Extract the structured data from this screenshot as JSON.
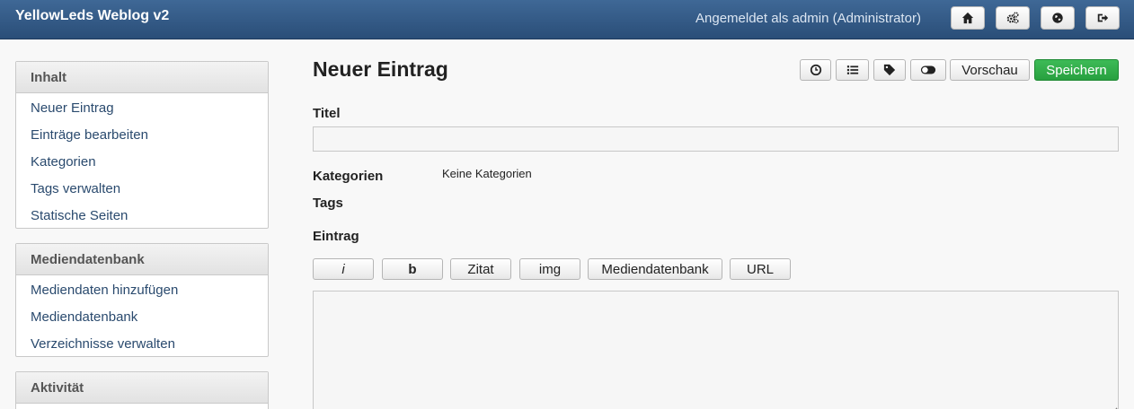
{
  "app": {
    "brand": "YellowLeds Weblog v2",
    "user_info": "Angemeldet als admin (Administrator)",
    "top_icons": [
      "home-icon",
      "settings-icon",
      "globe-icon",
      "logout-icon"
    ]
  },
  "sidebar": {
    "sections": [
      {
        "title": "Inhalt",
        "items": [
          "Neuer Eintrag",
          "Einträge bearbeiten",
          "Kategorien",
          "Tags verwalten",
          "Statische Seiten"
        ]
      },
      {
        "title": "Mediendatenbank",
        "items": [
          "Mediendaten hinzufügen",
          "Mediendatenbank",
          "Verzeichnisse verwalten"
        ]
      },
      {
        "title": "Aktivität",
        "items": []
      }
    ]
  },
  "main": {
    "title": "Neuer Eintrag",
    "toolbar": {
      "icons": [
        "clock-icon",
        "list-icon",
        "tag-icon",
        "toggle-icon"
      ],
      "preview_label": "Vorschau",
      "save_label": "Speichern"
    },
    "fields": {
      "title_label": "Titel",
      "title_value": "",
      "categories_label": "Kategorien",
      "categories_value": "Keine Kategorien",
      "tags_label": "Tags",
      "entry_label": "Eintrag"
    },
    "editor_buttons": [
      "i",
      "b",
      "Zitat",
      "img",
      "Mediendatenbank",
      "URL"
    ]
  },
  "colors": {
    "topbar": "#2f5682",
    "save_button": "#2ea646",
    "link": "#2a4a6e"
  }
}
